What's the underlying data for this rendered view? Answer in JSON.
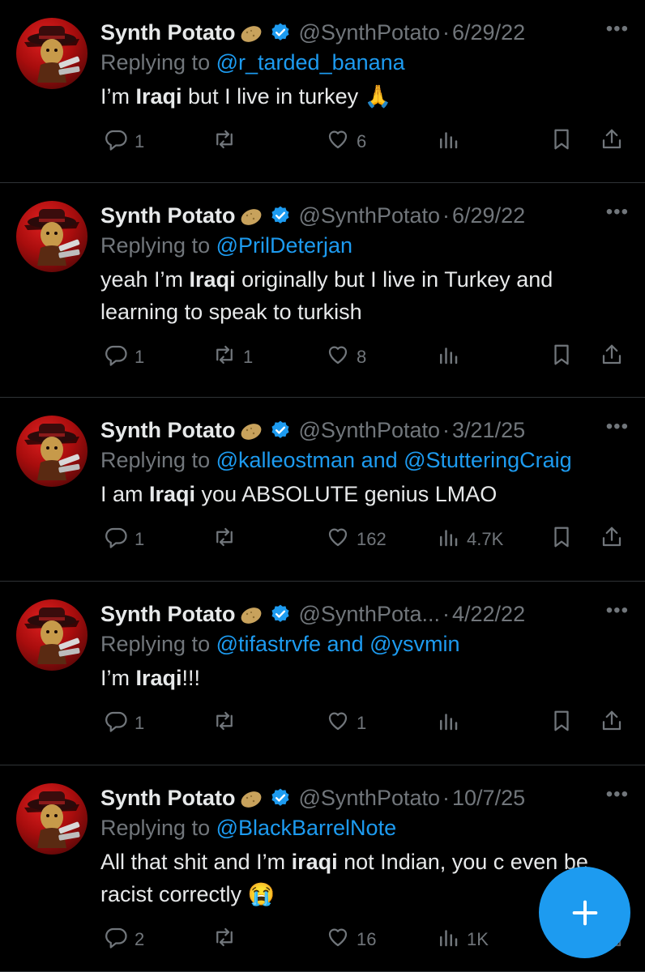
{
  "tweets": [
    {
      "name": "Synth Potato",
      "handle": "@SynthPotato",
      "date": "6/29/22",
      "reply_prefix": "Replying to ",
      "reply_to": "@r_tarded_banana",
      "text_parts": [
        "I’m ",
        "Iraqi",
        " but I live in turkey 🙏"
      ],
      "replies": "1",
      "retweets": "",
      "likes": "6",
      "views": ""
    },
    {
      "name": "Synth Potato",
      "handle": "@SynthPotato",
      "date": "6/29/22",
      "reply_prefix": "Replying to ",
      "reply_to": "@PrilDeterjan",
      "text_parts": [
        "yeah I’m ",
        "Iraqi",
        " originally but I live in Turkey and learning to speak to turkish"
      ],
      "replies": "1",
      "retweets": "1",
      "likes": "8",
      "views": ""
    },
    {
      "name": "Synth Potato",
      "handle": "@SynthPotato",
      "date": "3/21/25",
      "reply_prefix": "Replying to ",
      "reply_to": "@kalleostman and @StutteringCraig",
      "text_parts": [
        "I am ",
        "Iraqi",
        " you ABSOLUTE genius LMAO"
      ],
      "replies": "1",
      "retweets": "",
      "likes": "162",
      "views": "4.7K"
    },
    {
      "name": "Synth Potato",
      "handle": "@SynthPota...",
      "date": "4/22/22",
      "reply_prefix": "Replying to ",
      "reply_to": "@tifastrvfe and @ysvmin",
      "text_parts": [
        "I’m ",
        "Iraqi",
        "!!!"
      ],
      "replies": "1",
      "retweets": "",
      "likes": "1",
      "views": ""
    },
    {
      "name": "Synth Potato",
      "handle": "@SynthPotato",
      "date": "10/7/25",
      "reply_prefix": "Replying to ",
      "reply_to": "@BlackBarrelNote",
      "text_parts": [
        "All that shit and I’m ",
        "iraqi",
        " not Indian, you c      even be racist correctly 😭"
      ],
      "replies": "2",
      "retweets": "",
      "likes": "16",
      "views": "1K"
    }
  ],
  "separator": "·",
  "more_icon": "more-horizontal-icon",
  "compose_icon": "plus-icon",
  "colors": {
    "background": "#000000",
    "text": "#e7e9ea",
    "muted": "#71767b",
    "accent": "#1d9bf0",
    "border": "#2f3336"
  }
}
